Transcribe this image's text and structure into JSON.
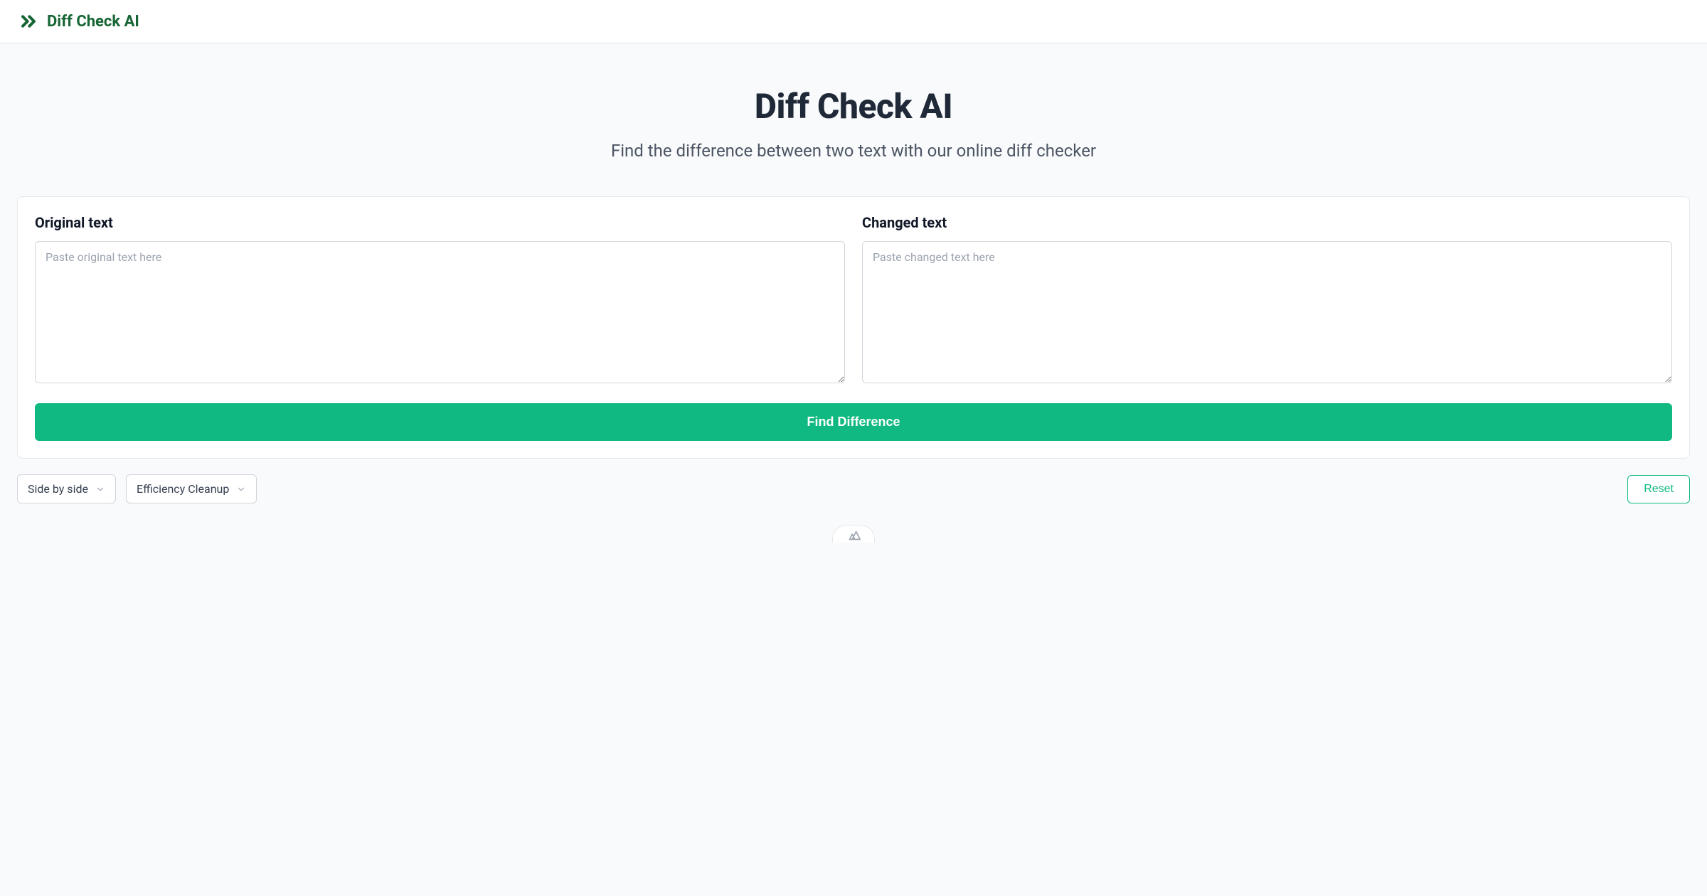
{
  "header": {
    "brand_name": "Diff Check AI"
  },
  "hero": {
    "title": "Diff Check AI",
    "subtitle": "Find the difference between two text with our online diff checker"
  },
  "inputs": {
    "original": {
      "label": "Original text",
      "placeholder": "Paste original text here",
      "value": ""
    },
    "changed": {
      "label": "Changed text",
      "placeholder": "Paste changed text here",
      "value": ""
    }
  },
  "actions": {
    "find_button": "Find Difference",
    "reset_button": "Reset"
  },
  "controls": {
    "view_mode": {
      "selected": "Side by side"
    },
    "cleanup_mode": {
      "selected": "Efficiency Cleanup"
    }
  },
  "colors": {
    "brand_green": "#166534",
    "accent_green": "#10b981",
    "text_dark": "#1f2937",
    "text_muted": "#4b5563",
    "border": "#e5e7eb"
  }
}
